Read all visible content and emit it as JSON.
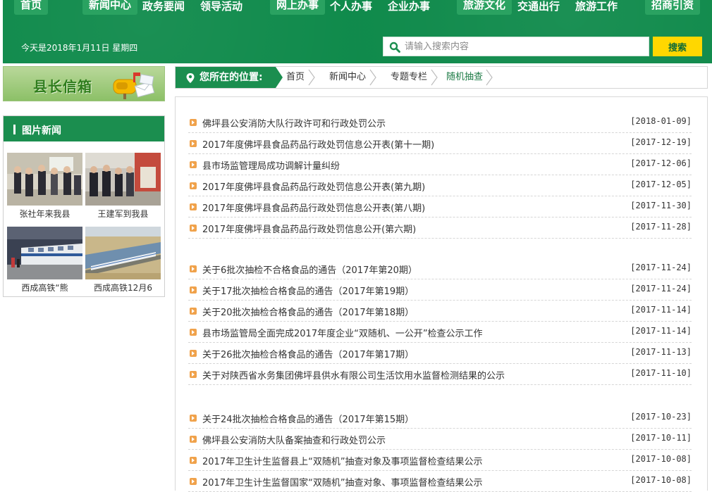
{
  "nav": {
    "items": [
      {
        "label": "首页",
        "boxed": true
      },
      {
        "label": "新闻中心",
        "boxed": true
      },
      {
        "label": "政务要闻",
        "boxed": false
      },
      {
        "label": "领导活动",
        "boxed": false
      },
      {
        "label": "网上办事",
        "boxed": true
      },
      {
        "label": "个人办事",
        "boxed": false
      },
      {
        "label": "企业办事",
        "boxed": false
      },
      {
        "label": "旅游文化",
        "boxed": true
      },
      {
        "label": "交通出行",
        "boxed": false
      },
      {
        "label": "旅游工作",
        "boxed": false
      },
      {
        "label": "招商引资",
        "boxed": true
      }
    ]
  },
  "header": {
    "date_text": "今天是2018年1月11日 星期四"
  },
  "search": {
    "placeholder": "请输入搜索内容",
    "button_label": "搜索"
  },
  "sidebar": {
    "mailbox_title": "县长信箱",
    "photo_news_title": "图片新闻",
    "photos": [
      {
        "caption": "张社年来我县"
      },
      {
        "caption": "王建军到我县"
      },
      {
        "caption": "西成高铁“熊"
      },
      {
        "caption": "西成高铁12月6"
      }
    ]
  },
  "breadcrumb": {
    "label": "您所在的位置:",
    "items": [
      "首页",
      "新闻中心",
      "专题专栏",
      "随机抽查"
    ]
  },
  "news": {
    "groups": [
      [
        {
          "title": "佛坪县公安消防大队行政许可和行政处罚公示",
          "date": "[2018-01-09]"
        },
        {
          "title": "2017年度佛坪县食品药品行政处罚信息公开表(第十一期)",
          "date": "[2017-12-19]"
        },
        {
          "title": "县市场监管理局成功调解计量纠纷",
          "date": "[2017-12-06]"
        },
        {
          "title": "2017年度佛坪县食品药品行政处罚信息公开表(第九期)",
          "date": "[2017-12-05]"
        },
        {
          "title": "2017年度佛坪县食品药品行政处罚信息公开表(第八期)",
          "date": "[2017-11-30]"
        },
        {
          "title": "2017年度佛坪县食品药品行政处罚信息公开(第六期)",
          "date": "[2017-11-28]"
        }
      ],
      [
        {
          "title": "关于6批次抽检不合格食品的通告（2017年第20期）",
          "date": "[2017-11-24]"
        },
        {
          "title": "关于17批次抽检合格食品的通告（2017年第19期）",
          "date": "[2017-11-24]"
        },
        {
          "title": "关于20批次抽检合格食品的通告（2017年第18期）",
          "date": "[2017-11-14]"
        },
        {
          "title": "县市场监管局全面完成2017年度企业“双随机、一公开”检查公示工作",
          "date": "[2017-11-14]"
        },
        {
          "title": "关于26批次抽检合格食品的通告（2017年第17期）",
          "date": "[2017-11-13]"
        },
        {
          "title": "关于对陕西省水务集团佛坪县供水有限公司生活饮用水监督检测结果的公示",
          "date": "[2017-11-10]"
        }
      ],
      [
        {
          "title": "关于24批次抽检合格食品的通告（2017年第15期）",
          "date": "[2017-10-23]"
        },
        {
          "title": "佛坪县公安消防大队备案抽查和行政处罚公示",
          "date": "[2017-10-11]"
        },
        {
          "title": "2017年卫生计生监督县上“双随机”抽查对象及事项监督检查结果公示",
          "date": "[2017-10-08]"
        },
        {
          "title": "2017年卫生计生监督国家“双随机”抽查对象、事项监督检查结果公示",
          "date": "[2017-10-08]"
        }
      ]
    ]
  }
}
